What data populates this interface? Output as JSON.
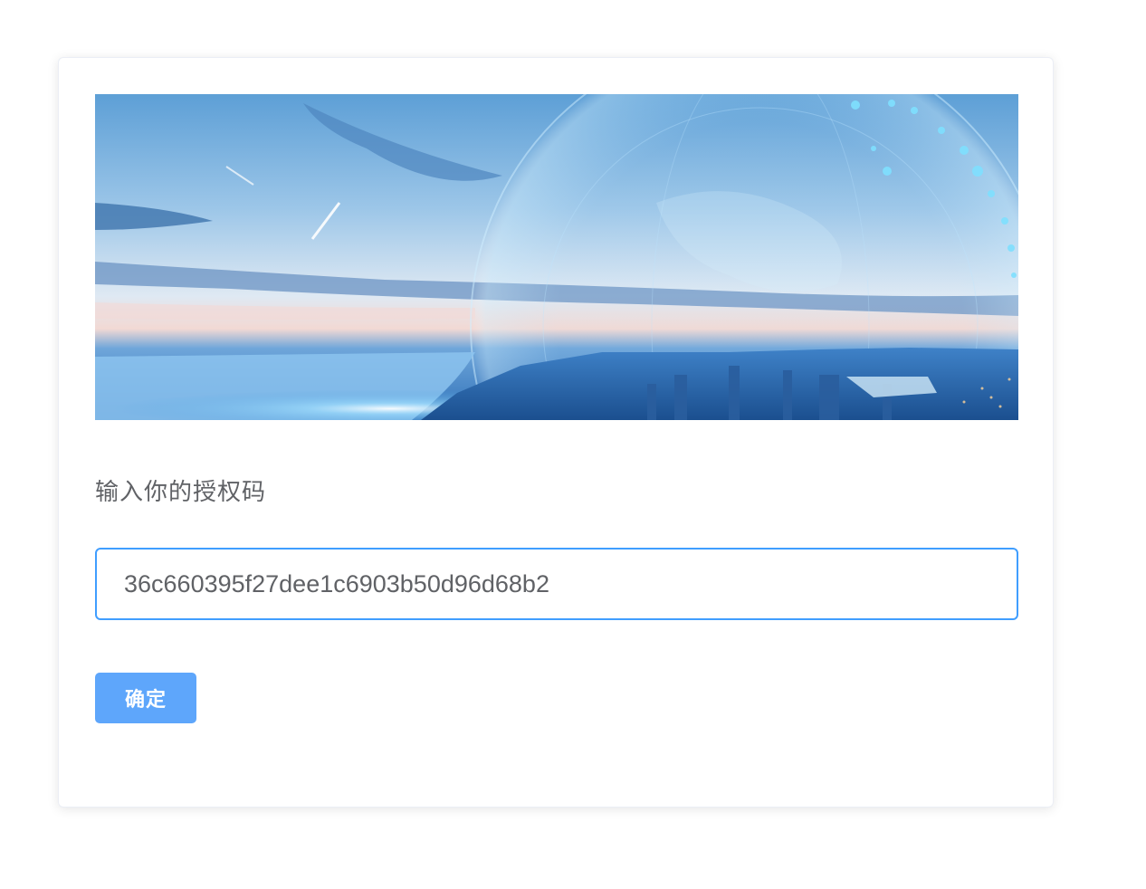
{
  "form": {
    "label": "输入你的授权码",
    "license_code_value": "36c660395f27dee1c6903b50d96d68b2",
    "confirm_label": "确定"
  },
  "banner": {
    "description_icon": "city-globe-banner-image"
  },
  "colors": {
    "accent": "#409eff",
    "button": "#5ea6fb",
    "label_text": "#606266"
  }
}
